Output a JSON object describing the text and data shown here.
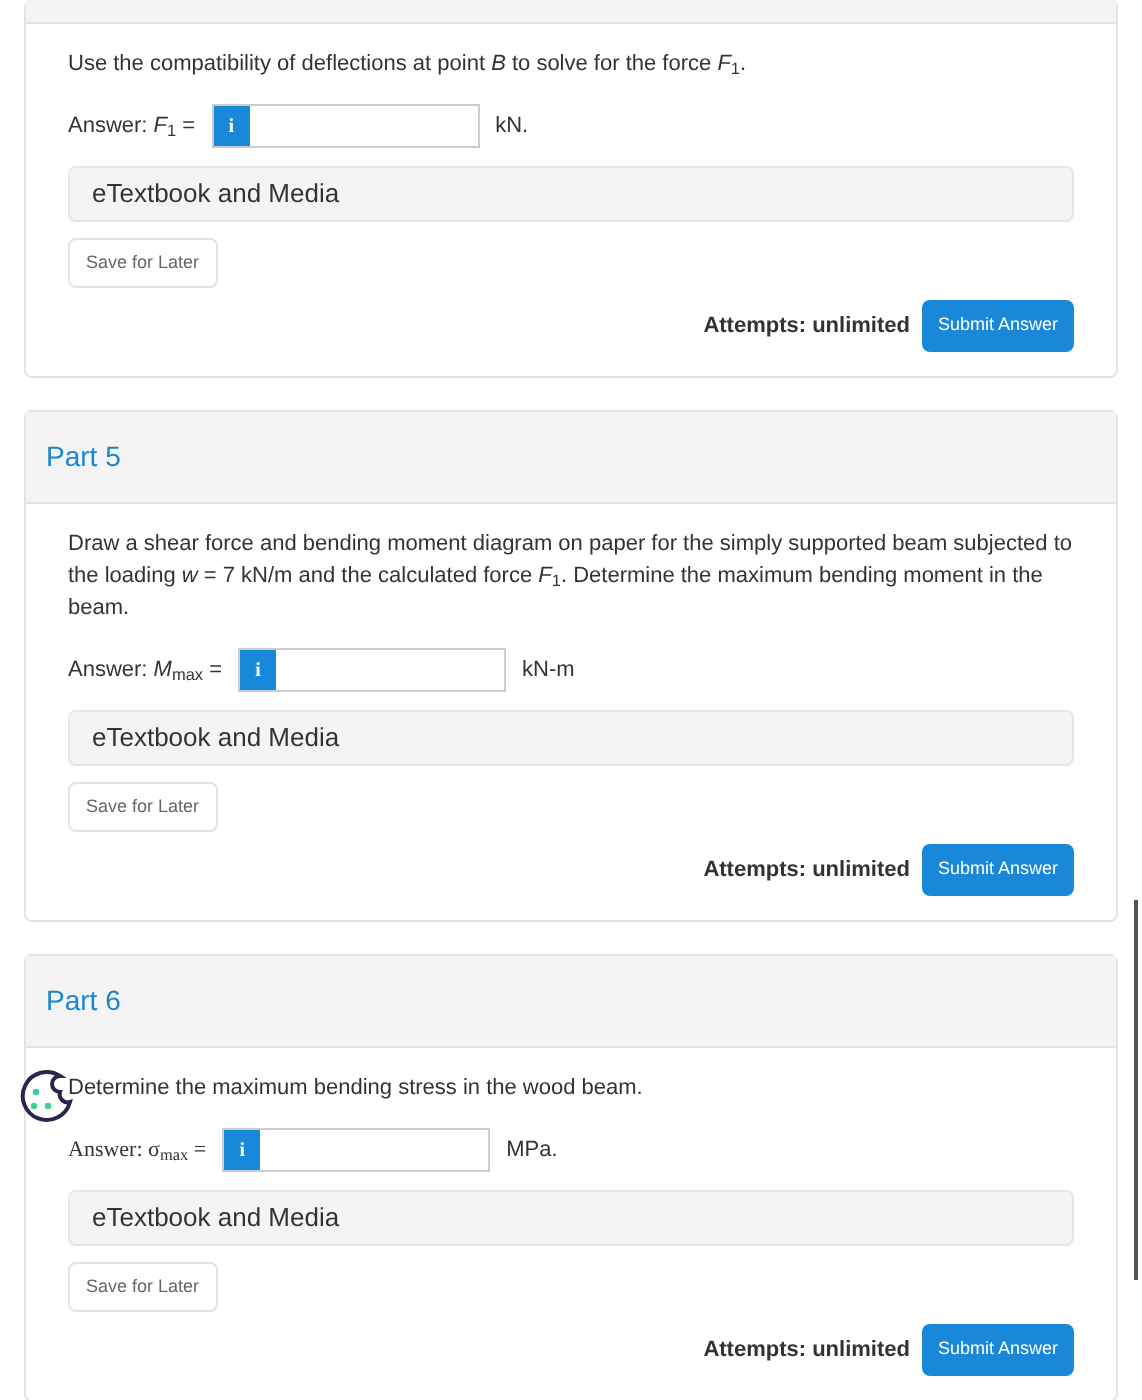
{
  "parts": [
    {
      "question": "Use the compatibility of deflections at point *B* to solve for the force *F*$_{1}$.",
      "answer": {
        "label": "Answer: *F*$_{1}$ =",
        "info": "i",
        "unit": "kN."
      },
      "media": "eTextbook and Media",
      "save": "Save for Later",
      "attempts": "Attempts: unlimited",
      "submit": "Submit Answer"
    },
    {
      "title": "Part 5",
      "question": "Draw a shear force and bending moment diagram on paper for the simply supported beam subjected to the loading *w* = 7 kN/m and the calculated force *F*$_{1}$. Determine the maximum bending moment in the beam.",
      "answer": {
        "label": "Answer: *M*$_{max}$ =",
        "info": "i",
        "unit": "kN-m"
      },
      "media": "eTextbook and Media",
      "save": "Save for Later",
      "attempts": "Attempts: unlimited",
      "submit": "Submit Answer"
    },
    {
      "title": "Part 6",
      "question": "Determine the maximum bending stress in the wood beam.",
      "answer": {
        "label": "Answer: σ$_{max}$ =",
        "info": "i",
        "unit": "MPa."
      },
      "media": "eTextbook and Media",
      "save": "Save for Later",
      "attempts": "Attempts: unlimited",
      "submit": "Submit Answer"
    }
  ]
}
